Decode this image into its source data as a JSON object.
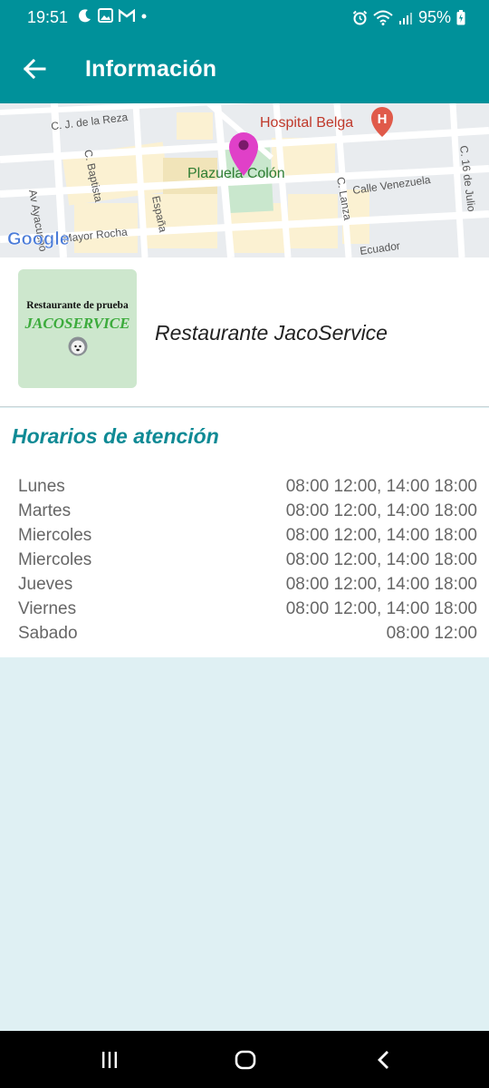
{
  "status_bar": {
    "time": "19:51",
    "battery_percent": "95%",
    "left_icons": [
      "moon-icon",
      "image-icon",
      "gmail-icon",
      "dot-icon"
    ],
    "right_icons": [
      "alarm-icon",
      "wifi-icon",
      "signal-icon",
      "battery-charging-icon"
    ]
  },
  "app_bar": {
    "title": "Información",
    "back_icon": "arrow-back-icon"
  },
  "map": {
    "labels": {
      "street_reza": "C. J. de la Reza",
      "hospital": "Hospital Belga",
      "plazuela": "Plazuela Colón",
      "baptista": "C. Baptista",
      "espana": "España",
      "lanza": "C. Lanza",
      "venezuela": "Calle Venezuela",
      "julio": "C. 16 de Julio",
      "ayacucho": "Av Ayacucho",
      "rocha": "Mayor Rocha",
      "ecuador": "Ecuador",
      "google": "Google"
    },
    "pin_color": "#e040c8"
  },
  "restaurant": {
    "logo_line1": "Restaurante de prueba",
    "logo_line2": "JACOSERVICE",
    "name": "Restaurante JacoService"
  },
  "hours": {
    "title": "Horarios de atención",
    "rows": [
      {
        "day": "Lunes",
        "time": "08:00 12:00, 14:00 18:00"
      },
      {
        "day": "Martes",
        "time": "08:00 12:00, 14:00 18:00"
      },
      {
        "day": "Miercoles",
        "time": "08:00 12:00, 14:00 18:00"
      },
      {
        "day": "Miercoles",
        "time": "08:00 12:00, 14:00 18:00"
      },
      {
        "day": "Jueves",
        "time": "08:00 12:00, 14:00 18:00"
      },
      {
        "day": "Viernes",
        "time": "08:00 12:00, 14:00 18:00"
      },
      {
        "day": "Sabado",
        "time": "08:00 12:00"
      }
    ]
  },
  "nav_bar": {
    "icons": [
      "recent-apps-icon",
      "home-icon",
      "back-icon"
    ]
  },
  "colors": {
    "primary": "#00919a",
    "accent_title": "#0f8a95",
    "background": "#dff0f3"
  }
}
